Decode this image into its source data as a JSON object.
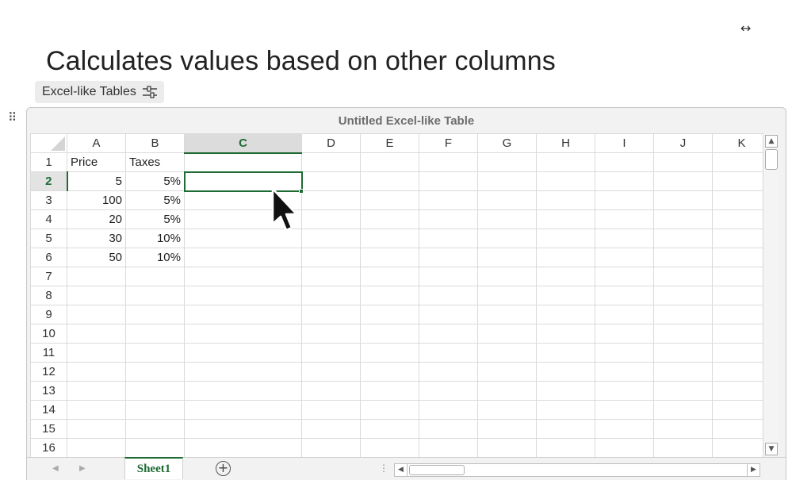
{
  "header": {
    "title": "Calculates values based on other columns",
    "tag_label": "Excel-like Tables"
  },
  "icons": {
    "expand": "horizontal-expand-arrows-icon",
    "tag": "sliders-icon",
    "drag": "drag-handle-icon",
    "add_sheet": "plus-circle-icon",
    "cursor": "mouse-pointer-icon"
  },
  "spreadsheet": {
    "title": "Untitled Excel-like Table",
    "columns": [
      "A",
      "B",
      "C",
      "D",
      "E",
      "F",
      "G",
      "H",
      "I",
      "J",
      "K"
    ],
    "selected_cell": "C2",
    "rows": [
      {
        "num": "1",
        "A": "Price",
        "B": "Taxes"
      },
      {
        "num": "2",
        "A": "5",
        "B": "5%"
      },
      {
        "num": "3",
        "A": "100",
        "B": "5%"
      },
      {
        "num": "4",
        "A": "20",
        "B": "5%"
      },
      {
        "num": "5",
        "A": "30",
        "B": "10%"
      },
      {
        "num": "6",
        "A": "50",
        "B": "10%"
      },
      {
        "num": "7",
        "A": "",
        "B": ""
      },
      {
        "num": "8",
        "A": "",
        "B": ""
      },
      {
        "num": "9",
        "A": "",
        "B": ""
      },
      {
        "num": "10",
        "A": "",
        "B": ""
      },
      {
        "num": "11",
        "A": "",
        "B": ""
      },
      {
        "num": "12",
        "A": "",
        "B": ""
      },
      {
        "num": "13",
        "A": "",
        "B": ""
      },
      {
        "num": "14",
        "A": "",
        "B": ""
      },
      {
        "num": "15",
        "A": "",
        "B": ""
      },
      {
        "num": "16",
        "A": "",
        "B": ""
      }
    ],
    "sheet_tab": "Sheet1",
    "accent_color": "#1e6b34"
  }
}
